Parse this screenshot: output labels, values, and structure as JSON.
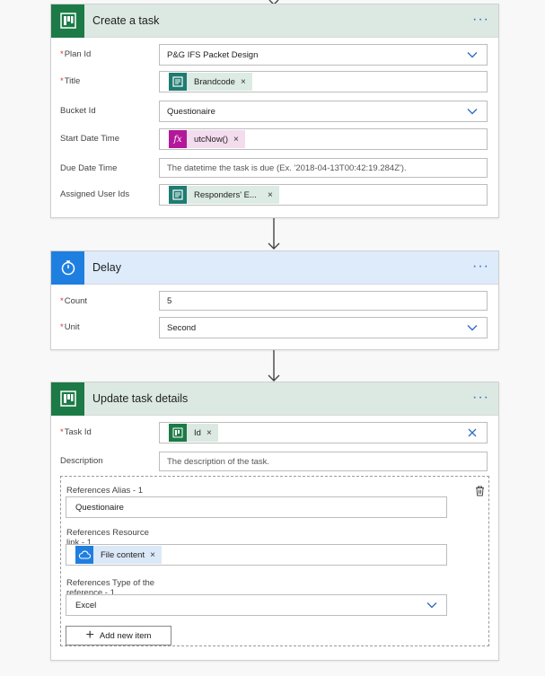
{
  "create_task": {
    "title": "Create a task",
    "more": "···",
    "fields": {
      "plan_id": {
        "label": "Plan Id",
        "value": "P&G IFS Packet Design"
      },
      "title": {
        "label": "Title",
        "chip": "Brandcode",
        "chip_close": "×"
      },
      "bucket_id": {
        "label": "Bucket Id",
        "value": "Questionaire"
      },
      "start_date": {
        "label": "Start Date Time",
        "chip": "utcNow()",
        "chip_icon": "fx",
        "chip_close": "×"
      },
      "due_date": {
        "label": "Due Date Time",
        "placeholder": "The datetime the task is due (Ex. '2018-04-13T00:42:19.284Z')."
      },
      "assigned": {
        "label": "Assigned User Ids",
        "chip": "Responders' E...",
        "chip_close": "×"
      }
    }
  },
  "delay": {
    "title": "Delay",
    "more": "···",
    "fields": {
      "count": {
        "label": "Count",
        "value": "5"
      },
      "unit": {
        "label": "Unit",
        "value": "Second"
      }
    }
  },
  "update_task": {
    "title": "Update task details",
    "more": "···",
    "fields": {
      "task_id": {
        "label": "Task Id",
        "chip": "Id",
        "chip_close": "×"
      },
      "description": {
        "label": "Description",
        "placeholder": "The description of the task."
      }
    },
    "references": {
      "alias": {
        "label": "References Alias - 1",
        "value": "Questionaire"
      },
      "resource_link": {
        "label_line1": "References Resource",
        "label_line2": "link - 1",
        "chip": "File content",
        "chip_close": "×"
      },
      "type": {
        "label_line1": "References Type of the",
        "label_line2": "reference - 1",
        "value": "Excel"
      },
      "add_button": {
        "plus": "+",
        "label": "Add new item"
      }
    }
  },
  "colors": {
    "planner_green": "#1c7a47",
    "delay_blue": "#1f7fe0",
    "required_red": "#d13438",
    "link_blue": "#2f6fc4"
  }
}
